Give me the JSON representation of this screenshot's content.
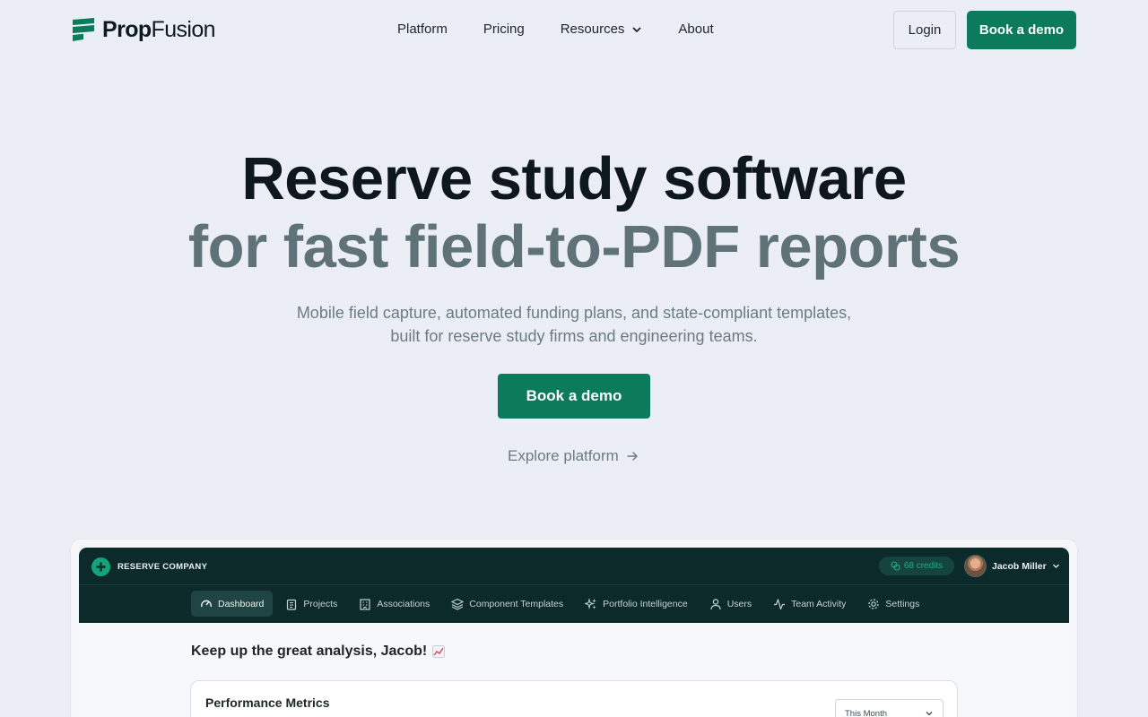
{
  "nav": {
    "brand_bold": "Prop",
    "brand_light": "Fusion",
    "links": [
      "Platform",
      "Pricing",
      "Resources",
      "About"
    ],
    "login": "Login",
    "cta": "Book a demo"
  },
  "hero": {
    "title_line1": "Reserve study software",
    "title_line2": "for fast field-to-PDF reports",
    "subtitle_line1": "Mobile field capture, automated funding plans, and state-compliant templates,",
    "subtitle_line2": "built for reserve study firms and engineering teams.",
    "cta": "Book a demo",
    "explore": "Explore platform"
  },
  "app_preview": {
    "company": "RESERVE COMPANY",
    "credits": "68 credits",
    "user_name": "Jacob Miller",
    "tabs": [
      "Dashboard",
      "Projects",
      "Associations",
      "Component Templates",
      "Portfolio Intelligence",
      "Users",
      "Team Activity",
      "Settings"
    ],
    "active_tab": "Dashboard",
    "greeting": "Keep up the great analysis, Jacob!",
    "metrics_title": "Performance Metrics",
    "period": "This Month"
  },
  "colors": {
    "page_bg": "#ebeff5",
    "brand_green": "#0b7b5c",
    "heading_dark": "#0d171c",
    "heading_muted": "#5f7278",
    "app_header": "#0d2a2b"
  },
  "icons": {
    "logo": "stacked-bars-logo-icon",
    "resources_chevron": "chevron-down-icon",
    "explore_arrow": "arrow-right-icon"
  }
}
